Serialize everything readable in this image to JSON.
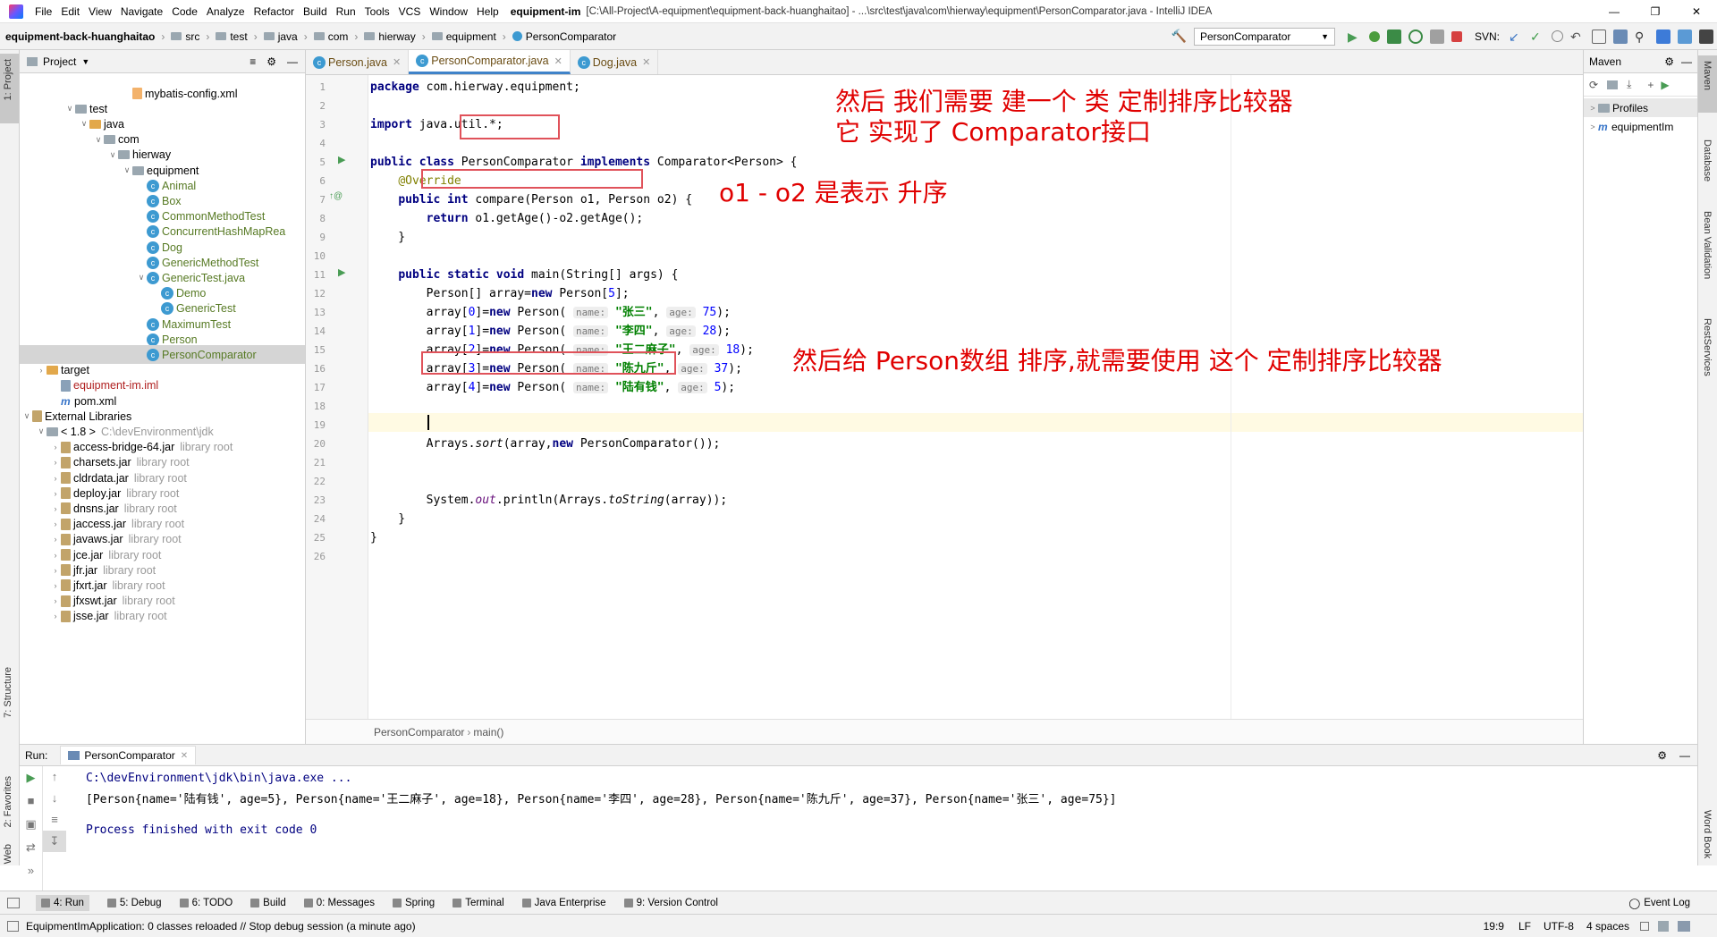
{
  "window": {
    "menu": [
      "File",
      "Edit",
      "View",
      "Navigate",
      "Code",
      "Analyze",
      "Refactor",
      "Build",
      "Run",
      "Tools",
      "VCS",
      "Window",
      "Help"
    ],
    "title_bold": "equipment-im",
    "title_rest": "[C:\\All-Project\\A-equipment\\equipment-back-huanghaitao] - ...\\src\\test\\java\\com\\hierway\\equipment\\PersonComparator.java - IntelliJ IDEA"
  },
  "nav": {
    "crumbs": [
      "equipment-back-huanghaitao",
      "src",
      "test",
      "java",
      "com",
      "hierway",
      "equipment",
      "PersonComparator"
    ],
    "run_config": "PersonComparator",
    "svn": "SVN:"
  },
  "sidebars": {
    "left": [
      "1: Project",
      "7: Structure",
      "2: Favorites",
      "Web"
    ],
    "right": [
      "Maven",
      "Database",
      "Bean Validation",
      "RestServices",
      "Word Book"
    ]
  },
  "project": {
    "title": "Project",
    "rows": [
      {
        "label": "mybatis-config.xml",
        "icon": "xml",
        "indent": 7,
        "arrow": ""
      },
      {
        "label": "test",
        "icon": "f",
        "indent": 3,
        "arrow": "v"
      },
      {
        "label": "java",
        "icon": "ft",
        "indent": 4,
        "arrow": "v"
      },
      {
        "label": "com",
        "icon": "f",
        "indent": 5,
        "arrow": "v"
      },
      {
        "label": "hierway",
        "icon": "f",
        "indent": 6,
        "arrow": "v"
      },
      {
        "label": "equipment",
        "icon": "f",
        "indent": 7,
        "arrow": "v"
      },
      {
        "label": "Animal",
        "icon": "c",
        "indent": 8,
        "arrow": "",
        "green": true
      },
      {
        "label": "Box",
        "icon": "c",
        "indent": 8,
        "arrow": "",
        "green": true
      },
      {
        "label": "CommonMethodTest",
        "icon": "c",
        "indent": 8,
        "arrow": "",
        "green": true
      },
      {
        "label": "ConcurrentHashMapRea",
        "icon": "c",
        "indent": 8,
        "arrow": "",
        "green": true
      },
      {
        "label": "Dog",
        "icon": "c",
        "indent": 8,
        "arrow": "",
        "green": true
      },
      {
        "label": "GenericMethodTest",
        "icon": "c",
        "indent": 8,
        "arrow": "",
        "green": true
      },
      {
        "label": "GenericTest.java",
        "icon": "c",
        "indent": 8,
        "arrow": "v",
        "green": true
      },
      {
        "label": "Demo",
        "icon": "c",
        "indent": 9,
        "arrow": "",
        "green": true
      },
      {
        "label": "GenericTest",
        "icon": "c",
        "indent": 9,
        "arrow": "",
        "green": true
      },
      {
        "label": "MaximumTest",
        "icon": "c",
        "indent": 8,
        "arrow": "",
        "green": true
      },
      {
        "label": "Person",
        "icon": "c",
        "indent": 8,
        "arrow": "",
        "green": true
      },
      {
        "label": "PersonComparator",
        "icon": "c",
        "indent": 8,
        "arrow": "",
        "green": true,
        "selected": true
      },
      {
        "label": "target",
        "icon": "ft",
        "indent": 1,
        "arrow": ">"
      },
      {
        "label": "equipment-im.iml",
        "icon": "iml",
        "indent": 2,
        "arrow": ""
      },
      {
        "label": "pom.xml",
        "icon": "m",
        "indent": 2,
        "arrow": ""
      },
      {
        "label": "External Libraries",
        "icon": "jar",
        "indent": 0,
        "arrow": "v"
      },
      {
        "label": "< 1.8 >",
        "dim": "C:\\devEnvironment\\jdk",
        "icon": "f",
        "indent": 1,
        "arrow": "v"
      },
      {
        "label": "access-bridge-64.jar",
        "dim": "library root",
        "icon": "jar",
        "indent": 2,
        "arrow": ">"
      },
      {
        "label": "charsets.jar",
        "dim": "library root",
        "icon": "jar",
        "indent": 2,
        "arrow": ">"
      },
      {
        "label": "cldrdata.jar",
        "dim": "library root",
        "icon": "jar",
        "indent": 2,
        "arrow": ">"
      },
      {
        "label": "deploy.jar",
        "dim": "library root",
        "icon": "jar",
        "indent": 2,
        "arrow": ">"
      },
      {
        "label": "dnsns.jar",
        "dim": "library root",
        "icon": "jar",
        "indent": 2,
        "arrow": ">"
      },
      {
        "label": "jaccess.jar",
        "dim": "library root",
        "icon": "jar",
        "indent": 2,
        "arrow": ">"
      },
      {
        "label": "javaws.jar",
        "dim": "library root",
        "icon": "jar",
        "indent": 2,
        "arrow": ">"
      },
      {
        "label": "jce.jar",
        "dim": "library root",
        "icon": "jar",
        "indent": 2,
        "arrow": ">"
      },
      {
        "label": "jfr.jar",
        "dim": "library root",
        "icon": "jar",
        "indent": 2,
        "arrow": ">"
      },
      {
        "label": "jfxrt.jar",
        "dim": "library root",
        "icon": "jar",
        "indent": 2,
        "arrow": ">"
      },
      {
        "label": "jfxswt.jar",
        "dim": "library root",
        "icon": "jar",
        "indent": 2,
        "arrow": ">"
      },
      {
        "label": "jsse.jar",
        "dim": "library root",
        "icon": "jar",
        "indent": 2,
        "arrow": ">"
      }
    ]
  },
  "tabs": [
    {
      "label": "Person.java",
      "active": false
    },
    {
      "label": "PersonComparator.java",
      "active": true
    },
    {
      "label": "Dog.java",
      "active": false
    }
  ],
  "code": {
    "line_numbers": [
      "1",
      "2",
      "3",
      "4",
      "5",
      "6",
      "7",
      "8",
      "9",
      "10",
      "11",
      "12",
      "13",
      "14",
      "15",
      "16",
      "17",
      "18",
      "19",
      "20",
      "21",
      "22",
      "23",
      "24",
      "25",
      "26"
    ],
    "lines": [
      [
        {
          "t": "package",
          "c": "kw"
        },
        {
          "t": " com.hierway.equipment;"
        }
      ],
      [],
      [
        {
          "t": "import",
          "c": "kw"
        },
        {
          "t": " java.util.*;"
        }
      ],
      [],
      [
        {
          "t": "public class",
          "c": "kw"
        },
        {
          "t": " PersonComparator "
        },
        {
          "t": "implements",
          "c": "kw"
        },
        {
          "t": " Comparator<Person> {"
        }
      ],
      [
        {
          "t": "    "
        },
        {
          "t": "@Override",
          "c": "an"
        }
      ],
      [
        {
          "t": "    "
        },
        {
          "t": "public int",
          "c": "kw"
        },
        {
          "t": " compare(Person o1, Person o2) {"
        }
      ],
      [
        {
          "t": "        "
        },
        {
          "t": "return",
          "c": "kw"
        },
        {
          "t": " o1.getAge()-o2.getAge();"
        }
      ],
      [
        {
          "t": "    }"
        }
      ],
      [],
      [
        {
          "t": "    "
        },
        {
          "t": "public static void",
          "c": "kw"
        },
        {
          "t": " main(String[] args) {"
        }
      ],
      [
        {
          "t": "        Person[] array="
        },
        {
          "t": "new",
          "c": "kw"
        },
        {
          "t": " Person["
        },
        {
          "t": "5",
          "c": "num"
        },
        {
          "t": "];"
        }
      ],
      [
        {
          "t": "        array["
        },
        {
          "t": "0",
          "c": "num"
        },
        {
          "t": "]="
        },
        {
          "t": "new",
          "c": "kw"
        },
        {
          "t": " Person( "
        },
        {
          "t": "name:",
          "c": "hint"
        },
        {
          "t": " "
        },
        {
          "t": "\"张三\"",
          "c": "str"
        },
        {
          "t": ", "
        },
        {
          "t": "age:",
          "c": "hint"
        },
        {
          "t": " "
        },
        {
          "t": "75",
          "c": "num"
        },
        {
          "t": ");"
        }
      ],
      [
        {
          "t": "        array["
        },
        {
          "t": "1",
          "c": "num"
        },
        {
          "t": "]="
        },
        {
          "t": "new",
          "c": "kw"
        },
        {
          "t": " Person( "
        },
        {
          "t": "name:",
          "c": "hint"
        },
        {
          "t": " "
        },
        {
          "t": "\"李四\"",
          "c": "str"
        },
        {
          "t": ", "
        },
        {
          "t": "age:",
          "c": "hint"
        },
        {
          "t": " "
        },
        {
          "t": "28",
          "c": "num"
        },
        {
          "t": ");"
        }
      ],
      [
        {
          "t": "        array["
        },
        {
          "t": "2",
          "c": "num"
        },
        {
          "t": "]="
        },
        {
          "t": "new",
          "c": "kw"
        },
        {
          "t": " Person( "
        },
        {
          "t": "name:",
          "c": "hint"
        },
        {
          "t": " "
        },
        {
          "t": "\"王二麻子\"",
          "c": "str"
        },
        {
          "t": ", "
        },
        {
          "t": "age:",
          "c": "hint"
        },
        {
          "t": " "
        },
        {
          "t": "18",
          "c": "num"
        },
        {
          "t": ");"
        }
      ],
      [
        {
          "t": "        array["
        },
        {
          "t": "3",
          "c": "num"
        },
        {
          "t": "]="
        },
        {
          "t": "new",
          "c": "kw"
        },
        {
          "t": " Person( "
        },
        {
          "t": "name:",
          "c": "hint"
        },
        {
          "t": " "
        },
        {
          "t": "\"陈九斤\"",
          "c": "str"
        },
        {
          "t": ", "
        },
        {
          "t": "age:",
          "c": "hint"
        },
        {
          "t": " "
        },
        {
          "t": "37",
          "c": "num"
        },
        {
          "t": ");"
        }
      ],
      [
        {
          "t": "        array["
        },
        {
          "t": "4",
          "c": "num"
        },
        {
          "t": "]="
        },
        {
          "t": "new",
          "c": "kw"
        },
        {
          "t": " Person( "
        },
        {
          "t": "name:",
          "c": "hint"
        },
        {
          "t": " "
        },
        {
          "t": "\"陆有钱\"",
          "c": "str"
        },
        {
          "t": ", "
        },
        {
          "t": "age:",
          "c": "hint"
        },
        {
          "t": " "
        },
        {
          "t": "5",
          "c": "num"
        },
        {
          "t": ");"
        }
      ],
      [],
      [
        {
          "t": "        "
        }
      ],
      [
        {
          "t": "        Arrays."
        },
        {
          "t": "sort",
          "c": "it"
        },
        {
          "t": "(array,"
        },
        {
          "t": "new",
          "c": "kw"
        },
        {
          "t": " PersonComparator());"
        }
      ],
      [],
      [],
      [
        {
          "t": "        System."
        },
        {
          "t": "out",
          "c": "fld"
        },
        {
          "t": ".println(Arrays."
        },
        {
          "t": "toString",
          "c": "it"
        },
        {
          "t": "(array));"
        }
      ],
      [
        {
          "t": "    }"
        }
      ],
      [
        {
          "t": "}"
        }
      ],
      []
    ]
  },
  "annotations": {
    "note1": "然后   我们需要   建一个    类     定制排序比较器",
    "note2": "它   实现了  Comparator接口",
    "note3": "o1  -  o2  是表示   升序",
    "note4": "然后给   Person数组  排序,就需要使用  这个  定制排序比较器",
    "color": "#e00000"
  },
  "editor_breadcrumb": [
    "PersonComparator",
    "main()"
  ],
  "maven": {
    "title": "Maven",
    "items": [
      "Profiles",
      "equipmentIm"
    ]
  },
  "run": {
    "label": "Run:",
    "tab": "PersonComparator",
    "cmd": "C:\\devEnvironment\\jdk\\bin\\java.exe ...",
    "output": "[Person{name='陆有钱', age=5}, Person{name='王二麻子', age=18}, Person{name='李四', age=28}, Person{name='陈九斤', age=37}, Person{name='张三', age=75}]",
    "exit": "Process finished with exit code 0"
  },
  "toolwindows": [
    "4: Run",
    "5: Debug",
    "6: TODO",
    "Build",
    "0: Messages",
    "Spring",
    "Terminal",
    "Java Enterprise",
    "9: Version Control"
  ],
  "event_log": "Event Log",
  "status": {
    "message": "EquipmentImApplication: 0 classes reloaded // Stop debug session (a minute ago)",
    "position": "19:9",
    "line_sep": "LF",
    "encoding": "UTF-8",
    "indent": "4 spaces"
  }
}
